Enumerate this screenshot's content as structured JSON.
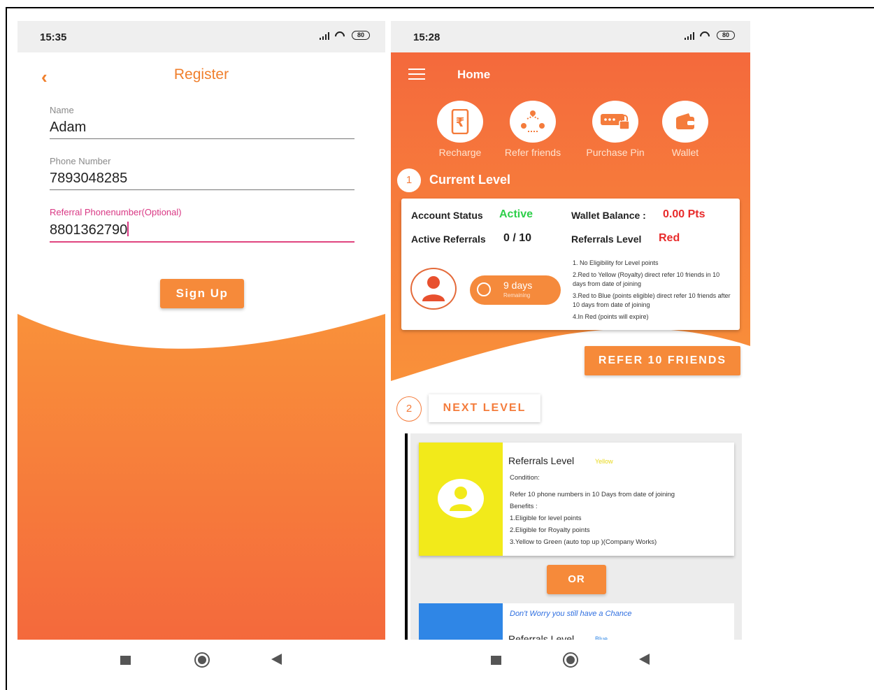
{
  "left": {
    "status": {
      "time": "15:35",
      "battery": "80"
    },
    "title": "Register",
    "name_label": "Name",
    "name_value": "Adam",
    "phone_label": "Phone Number",
    "phone_value": "7893048285",
    "referral_label": "Referral Phonenumber(Optional)",
    "referral_value": "8801362790",
    "signup_label": "Sign Up"
  },
  "right": {
    "status": {
      "time": "15:28",
      "battery": "80"
    },
    "title": "Home",
    "quick_actions": [
      {
        "label": "Recharge",
        "icon": "rupee-phone-icon"
      },
      {
        "label": "Refer friends",
        "icon": "group-icon"
      },
      {
        "label": "Purchase Pin",
        "icon": "pin-lock-icon"
      },
      {
        "label": "Wallet",
        "icon": "wallet-icon"
      }
    ],
    "current_level": {
      "step": "1",
      "title": "Current Level",
      "account_status_label": "Account Status",
      "account_status_value": "Active",
      "wallet_balance_label": "Wallet Balance :",
      "wallet_balance_value": "0.00 Pts",
      "active_referrals_label": "Active Referrals",
      "active_referrals_value": "0 / 10",
      "referrals_level_label": "Referrals Level",
      "referrals_level_value": "Red",
      "days_value": "9 days",
      "days_sub": "Remaining",
      "rules": [
        "1. No Eligibility for Level points",
        "2.Red to Yellow (Royalty) direct refer 10 friends in 10 days from date of joining",
        "3.Red to Blue (points eligible) direct refer 10 friends after 10 days from date of joining",
        "4.In Red (points will expire)"
      ]
    },
    "refer_button": "REFER 10 FRIENDS",
    "next_level": {
      "step": "2",
      "title": "NEXT LEVEL"
    },
    "yellow_card": {
      "title": "Referrals Level",
      "tag": "Yellow",
      "lines": [
        "Condition:",
        "",
        "Refer 10 phone numbers in 10 Days from date of joining",
        "Benefits :",
        "1.Eligible for level points",
        "2.Eligible for Royalty points",
        "3.Yellow to Green (auto top up )(Company Works)"
      ]
    },
    "or_label": "OR",
    "blue_card": {
      "note": "Don't Worry you still have a Chance",
      "title": "Referrals Level",
      "tag": "Blue"
    }
  },
  "colors": {
    "accent": "#f47c3c",
    "orange_light": "#f68a3a",
    "yellow": "#f2ea1a",
    "blue": "#2f86e6",
    "active_green": "#2ecf4a",
    "red": "#e82b2b"
  }
}
